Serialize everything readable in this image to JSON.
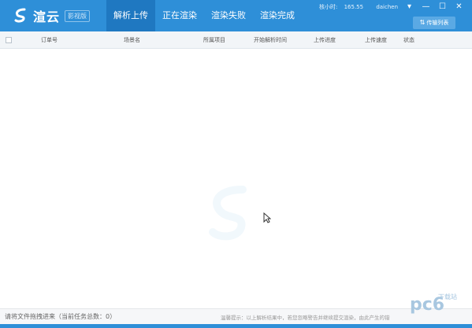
{
  "app": {
    "logo_text": "渲云",
    "logo_badge": "影视版"
  },
  "tabs": [
    {
      "label": "解析上传",
      "active": true
    },
    {
      "label": "正在渲染",
      "active": false
    },
    {
      "label": "渲染失败",
      "active": false
    },
    {
      "label": "渲染完成",
      "active": false
    }
  ],
  "account": {
    "balance_label": "核小时:",
    "balance_value": "165.55",
    "username": "daichen"
  },
  "window_controls": {
    "menu": "▾",
    "minimize": "—",
    "maximize": "☐",
    "close": "✕"
  },
  "transfer_button": {
    "label": "传输列表"
  },
  "table": {
    "columns": [
      "订单号",
      "场景名",
      "所属项目",
      "开始解析时间",
      "上传进度",
      "上传速度",
      "状态"
    ],
    "rows": []
  },
  "footer": {
    "drag_tip": "请将文件拖拽进来（当前任务总数：0）",
    "hint": "温馨提示：以上解析结果中，若您忽略警告并继续提交渲染，由此产生的错误，我方将不予以赔偿。"
  },
  "watermark": {
    "text": "pc6",
    "sub": "下载站"
  },
  "colors": {
    "brand_blue": "#2e8fd8",
    "active_tab": "#1f78c1"
  }
}
